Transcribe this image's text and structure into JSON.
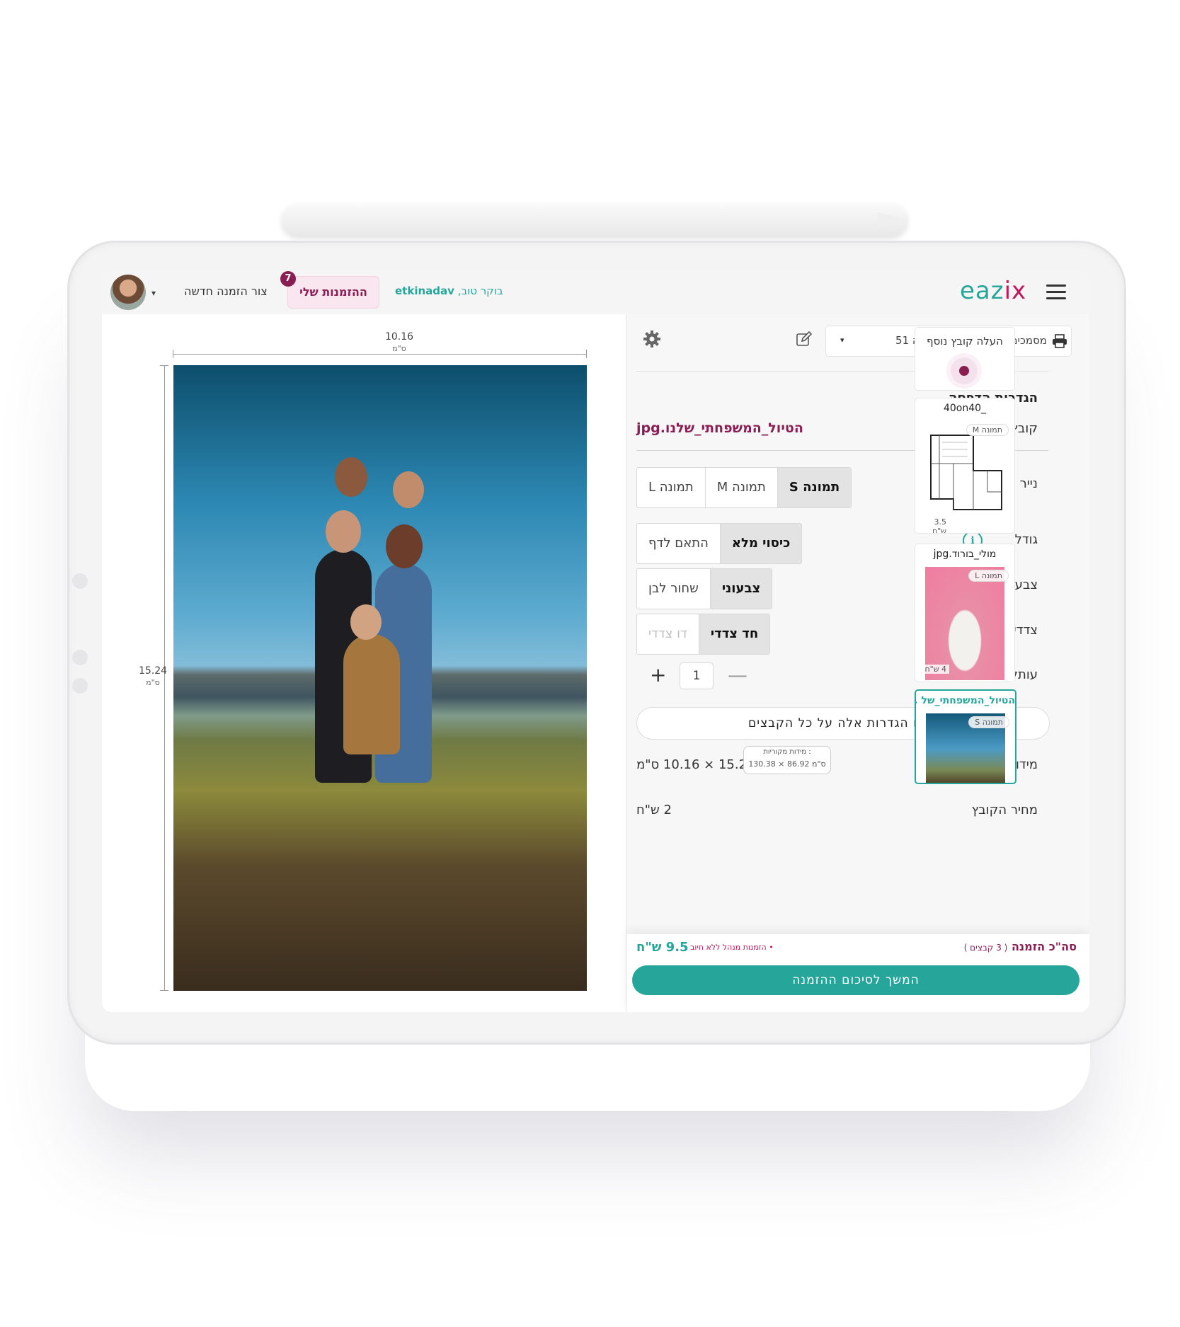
{
  "header": {
    "greeting_prefix": "בוקר טוב,",
    "username": "etkinadav",
    "my_orders_label": "ההזמנות שלי",
    "orders_badge": "7",
    "new_order_label": "צור הזמנה חדשה",
    "logo_teal": "eaz",
    "logo_pink": "ix",
    "caret": "▾"
  },
  "preview": {
    "width_value": "10.16",
    "width_unit": "ס\"מ",
    "height_value": "15.24",
    "height_unit": "ס\"מ"
  },
  "toolbar": {
    "printer_label": "מסמכים ותמו' , תמונות בקפה 51",
    "caret": "▾"
  },
  "settings": {
    "title": "הגדרות הדפסה",
    "file_label": "קובץ",
    "file_name": "הטיול_המשפחתי_שלנו.jpg",
    "paper_label": "נייר",
    "paper_options": [
      "תמונה S",
      "תמונה M",
      "תמונה L"
    ],
    "paper_selected": "תמונה S",
    "size_label": "גודל",
    "size_options": [
      "כיסוי מלא",
      "התאם לדף"
    ],
    "color_label": "צבע",
    "color_options": [
      "צבעוני",
      "שחור לבן"
    ],
    "sides_label": "צדדים",
    "sides_options": [
      "חד צדדי",
      "דו צדדי"
    ],
    "copies_label": "עותקים",
    "copies_value": "1",
    "plus": "+",
    "minus": "—",
    "info_glyph": "i",
    "apply_all_label": "יישם הגדרות אלה על כל הקבצים",
    "dims_label": "מידות",
    "dims_value": "15.24 × 10.16 ס\"מ",
    "orig_title": "מידות מקוריות :",
    "orig_value": "130.38 × 86.92 ס\"מ",
    "price_label": "מחיר הקובץ",
    "price_value": "2 ש\"ח"
  },
  "files": {
    "upload_label": "העלה קובץ נוסף",
    "items": [
      {
        "name": "_40on40",
        "type": "תמונה M",
        "price": "3.5 ש\"ח"
      },
      {
        "name": "מולי_בורוד.jpg",
        "type": "תמונה L",
        "price": "4 ש\"ח"
      },
      {
        "name": "הטיול_המשפחתי_של ...",
        "type": "תמונה S",
        "price": ""
      }
    ]
  },
  "footer": {
    "total_title": "סה\"כ הזמנה",
    "total_count": "( 3 קבצים )",
    "note": "• הזמנות מנהל ללא חיוב •",
    "total_price": "9.5 ש\"ח",
    "continue_label": "המשך לסיכום ההזמנה"
  },
  "colors": {
    "teal": "#26a69a",
    "magenta": "#8a1e52",
    "pink": "#c2185b"
  }
}
